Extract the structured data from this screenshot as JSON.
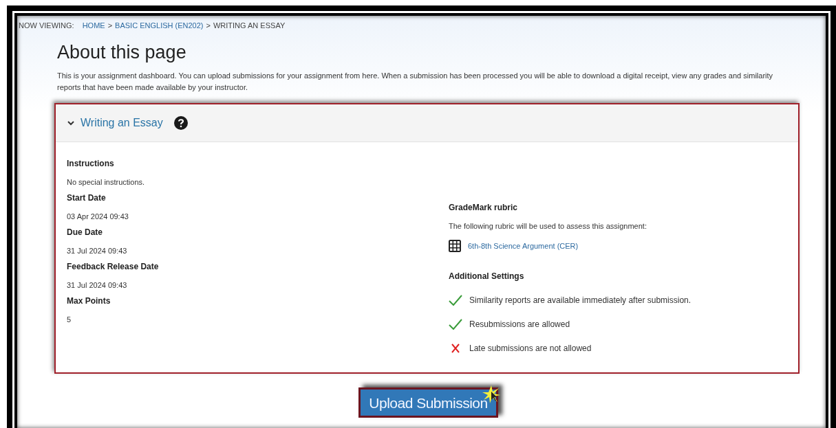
{
  "breadcrumb": {
    "label": "NOW VIEWING:",
    "separator": ">",
    "items": [
      {
        "text": "HOME",
        "kind": "link"
      },
      {
        "text": "BASIC ENGLISH (EN202)",
        "kind": "link"
      },
      {
        "text": "WRITING AN ESSAY",
        "kind": "current"
      }
    ]
  },
  "heading": "About this page",
  "intro": "This is your assignment dashboard. You can upload submissions for your assignment from here. When a submission has been processed you will be able to download a digital receipt, view any grades and similarity reports that have been made available by your instructor.",
  "assignment": {
    "title": "Writing an Essay",
    "expanded": true,
    "left": [
      {
        "label": "Instructions",
        "value": "No special instructions."
      },
      {
        "label": "Start Date",
        "value": "03 Apr 2024 09:43"
      },
      {
        "label": "Due Date",
        "value": "31 Jul 2024 09:43"
      },
      {
        "label": "Feedback Release Date",
        "value": "31 Jul 2024 09:43"
      },
      {
        "label": "Max Points",
        "value": "5"
      }
    ],
    "rubric": {
      "label": "GradeMark rubric",
      "description": "The following rubric will be used to assess this assignment:",
      "link": "6th-8th Science Argument (CER)"
    },
    "settings_label": "Additional Settings",
    "settings": [
      {
        "text": "Similarity reports are available immediately after submission.",
        "allowed": true
      },
      {
        "text": "Resubmissions are allowed",
        "allowed": true
      },
      {
        "text": "Late submissions are not allowed",
        "allowed": false
      }
    ]
  },
  "upload_button": "Upload Submission"
}
